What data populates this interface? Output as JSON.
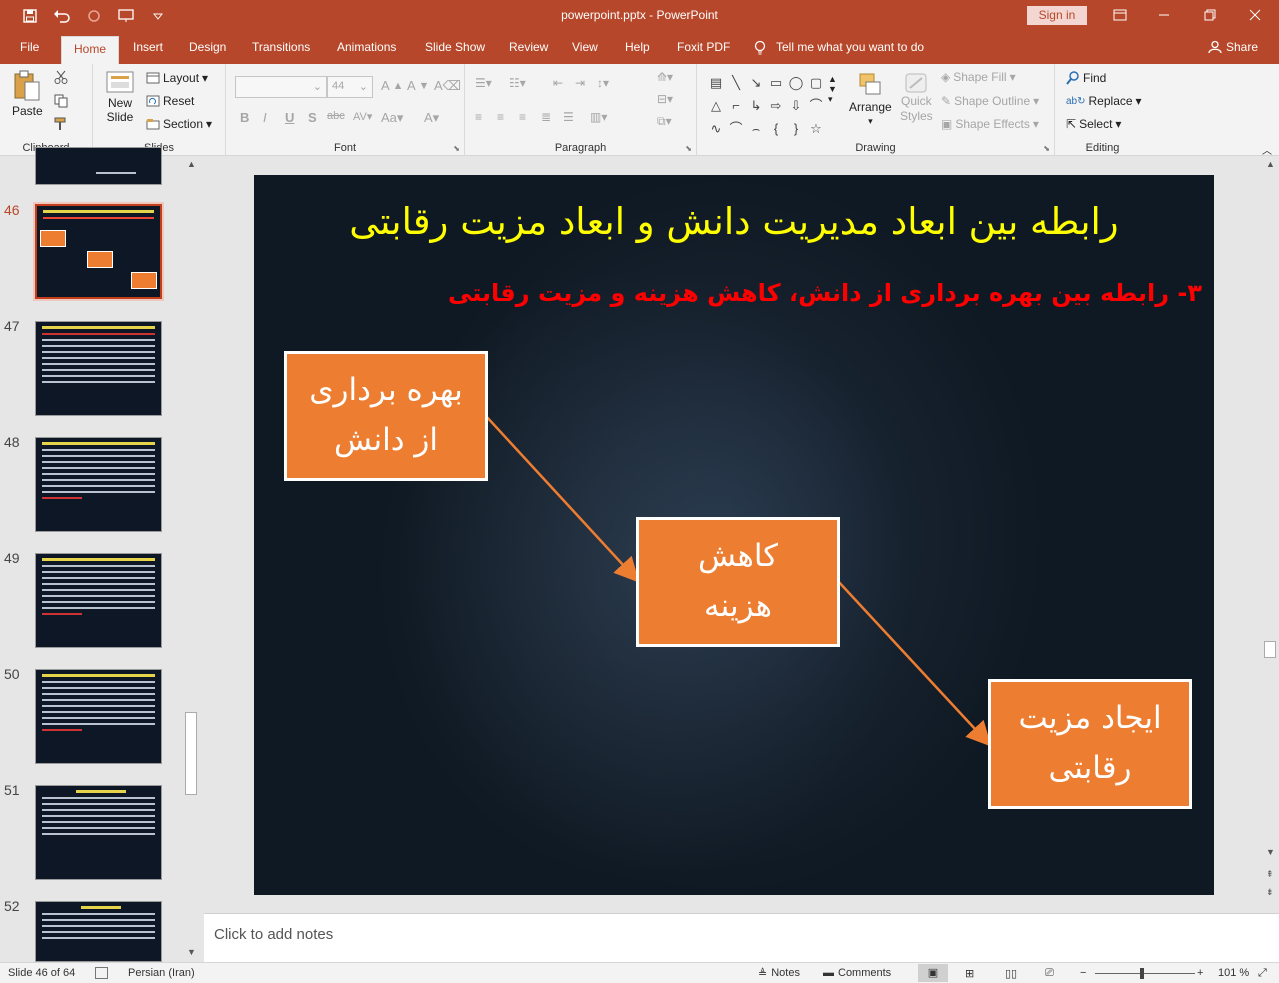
{
  "window": {
    "title": "powerpoint.pptx  -  PowerPoint",
    "sign_in": "Sign in"
  },
  "tabs": [
    "File",
    "Home",
    "Insert",
    "Design",
    "Transitions",
    "Animations",
    "Slide Show",
    "Review",
    "View",
    "Help",
    "Foxit PDF",
    "Tell me what you want to do"
  ],
  "active_tab": "Home",
  "share": "Share",
  "ribbon": {
    "clipboard": {
      "label": "Clipboard",
      "paste": "Paste"
    },
    "slides": {
      "label": "Slides",
      "new_slide_1": "New",
      "new_slide_2": "Slide",
      "layout": "Layout",
      "reset": "Reset",
      "section": "Section"
    },
    "font": {
      "label": "Font",
      "size": "44"
    },
    "paragraph": {
      "label": "Paragraph"
    },
    "drawing": {
      "label": "Drawing",
      "arrange": "Arrange",
      "quick_1": "Quick",
      "quick_2": "Styles",
      "shape_fill": "Shape Fill",
      "shape_outline": "Shape Outline",
      "shape_effects": "Shape Effects"
    },
    "editing": {
      "label": "Editing",
      "find": "Find",
      "replace": "Replace",
      "select": "Select"
    }
  },
  "thumbnails": [
    "46",
    "47",
    "48",
    "49",
    "50",
    "51",
    "52"
  ],
  "active_slide": "46",
  "slide": {
    "title": "رابطه بین ابعاد مدیریت دانش و ابعاد مزیت رقابتی",
    "subtitle": "۳- رابطه بین بهره برداری از دانش، کاهش هزینه و مزیت رقابتی",
    "box1_line1": "بهره برداری",
    "box1_line2": "از دانش",
    "box2_line1": "کاهش",
    "box2_line2": "هزینه",
    "box3_line1": "ایجاد مزیت",
    "box3_line2": "رقابتی",
    "box_color": "#ed7d31",
    "arrow_color": "#ed7d31"
  },
  "notes_placeholder": "Click to add notes",
  "status": {
    "slide_info": "Slide 46 of 64",
    "language": "Persian (Iran)",
    "notes": "Notes",
    "comments": "Comments",
    "zoom": "101 %"
  },
  "colors": {
    "accent": "#b7472a",
    "title_yellow": "#ffff00",
    "subtitle_red": "#ff0000"
  }
}
